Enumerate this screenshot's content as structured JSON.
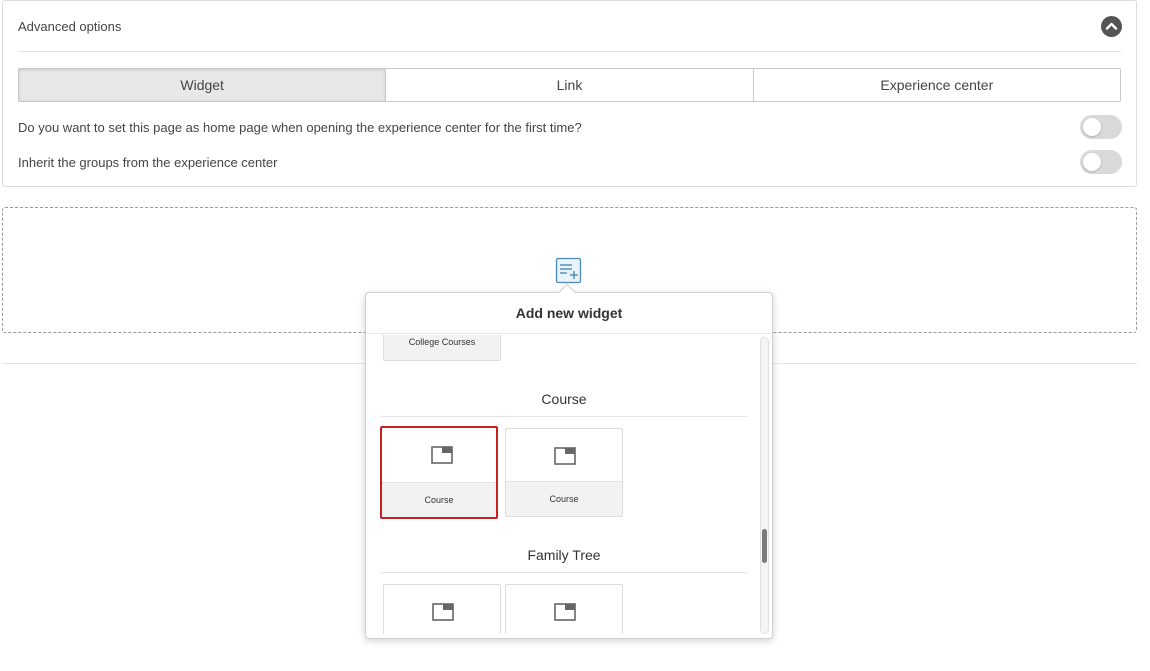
{
  "advanced": {
    "title": "Advanced options",
    "tabs": [
      {
        "label": "Widget",
        "active": true
      },
      {
        "label": "Link",
        "active": false
      },
      {
        "label": "Experience center",
        "active": false
      }
    ],
    "options": [
      {
        "label": "Do you want to set this page as home page when opening the experience center for the first time?",
        "enabled": false
      },
      {
        "label": "Inherit the groups from the experience center",
        "enabled": false
      }
    ]
  },
  "popup": {
    "title": "Add new widget",
    "prev_tile_label": "College Courses",
    "sections": [
      {
        "title": "Course",
        "tiles": [
          {
            "label": "Course",
            "selected": true
          },
          {
            "label": "Course",
            "selected": false
          }
        ]
      },
      {
        "title": "Family Tree",
        "tiles": [
          {
            "label": "",
            "selected": false
          },
          {
            "label": "",
            "selected": false
          }
        ]
      }
    ]
  },
  "colors": {
    "selected_border": "#cc1f1f",
    "active_tab_bg": "#e8e8e8",
    "icon_blue": "#4a8ab8"
  }
}
